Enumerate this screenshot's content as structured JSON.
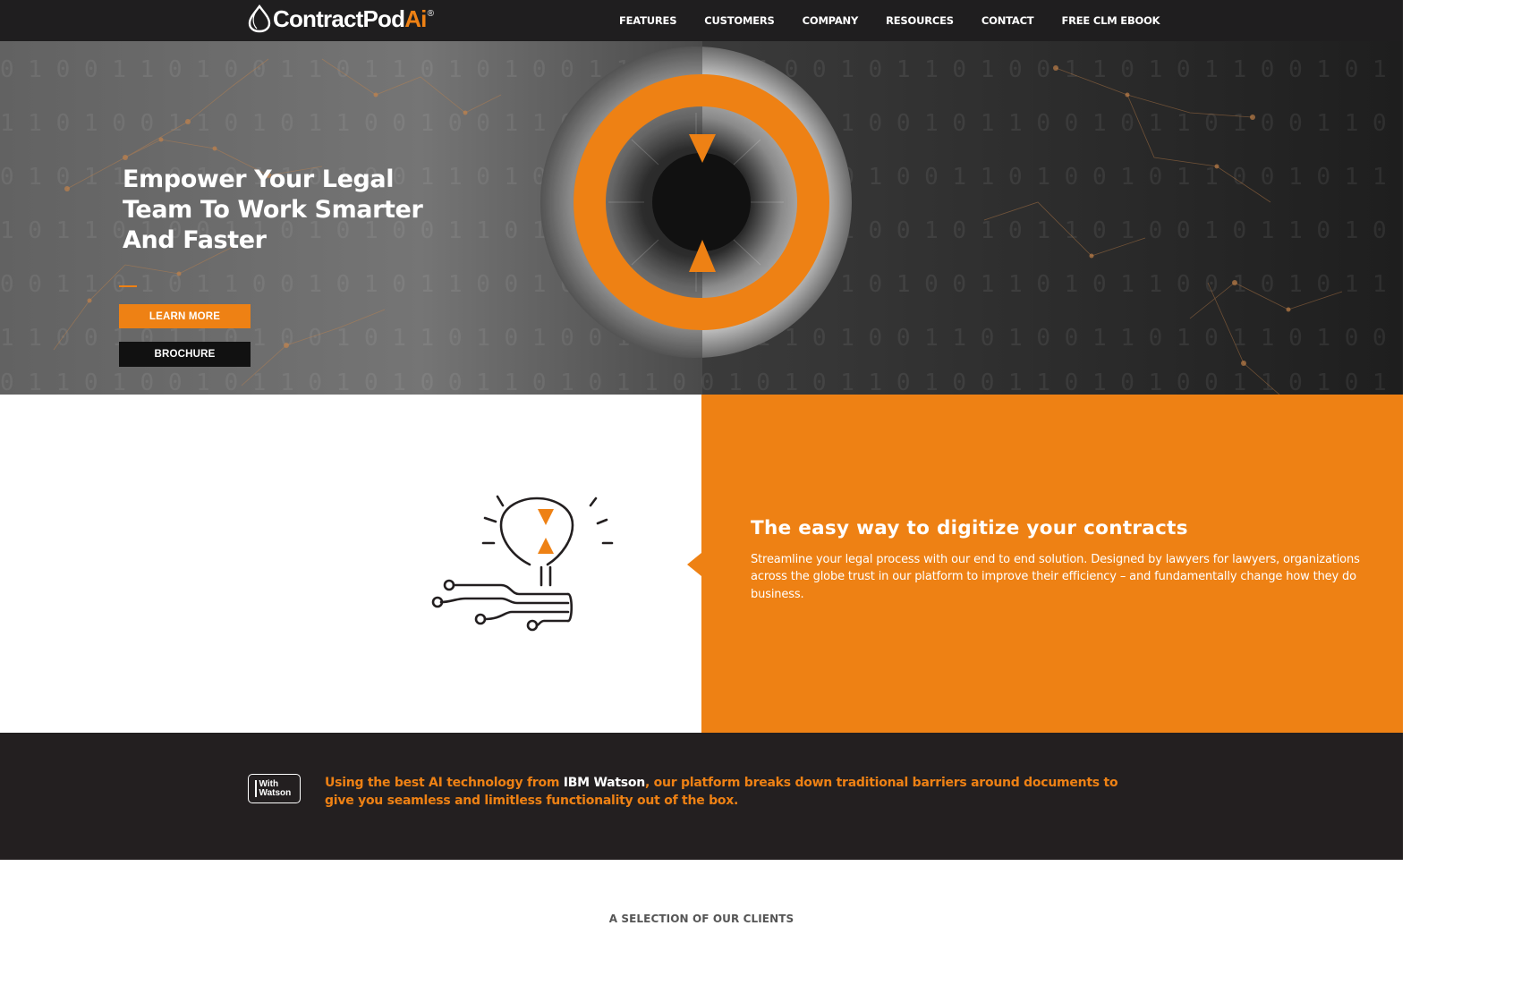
{
  "nav": {
    "logo": {
      "text_main": "ContractPod",
      "text_accent": "Ai",
      "registered": "®"
    },
    "links": [
      "FEATURES",
      "CUSTOMERS",
      "COMPANY",
      "RESOURCES",
      "CONTACT",
      "FREE CLM EBOOK"
    ]
  },
  "hero": {
    "title": "Empower Your Legal Team To Work Smarter And Faster",
    "learn_more_label": "LEARN MORE",
    "brochure_label": "BROCHURE"
  },
  "digitize": {
    "title": "The easy way to digitize your contracts",
    "body": "Streamline your legal process with our end to end solution. Designed by lawyers for lawyers, organizations across the globe trust in our platform to improve their efficiency – and fundamentally change how they do business."
  },
  "watson": {
    "badge_line1": "With",
    "badge_line2": "Watson",
    "text_before": "Using the best AI technology from ",
    "text_highlight": "IBM Watson",
    "text_after": ", our platform breaks down traditional barriers around documents to give you seamless and limitless functionality out of the box."
  },
  "clients": {
    "heading": "A SELECTION OF OUR CLIENTS"
  },
  "colors": {
    "accent": "#ee8114",
    "dark": "#1f1e1f",
    "strip": "#231f20",
    "white": "#ffffff"
  },
  "icons": [
    "logo-drop-icon",
    "eye-hourglass-graphic",
    "lightbulb-circuit-icon",
    "watson-badge-icon"
  ]
}
